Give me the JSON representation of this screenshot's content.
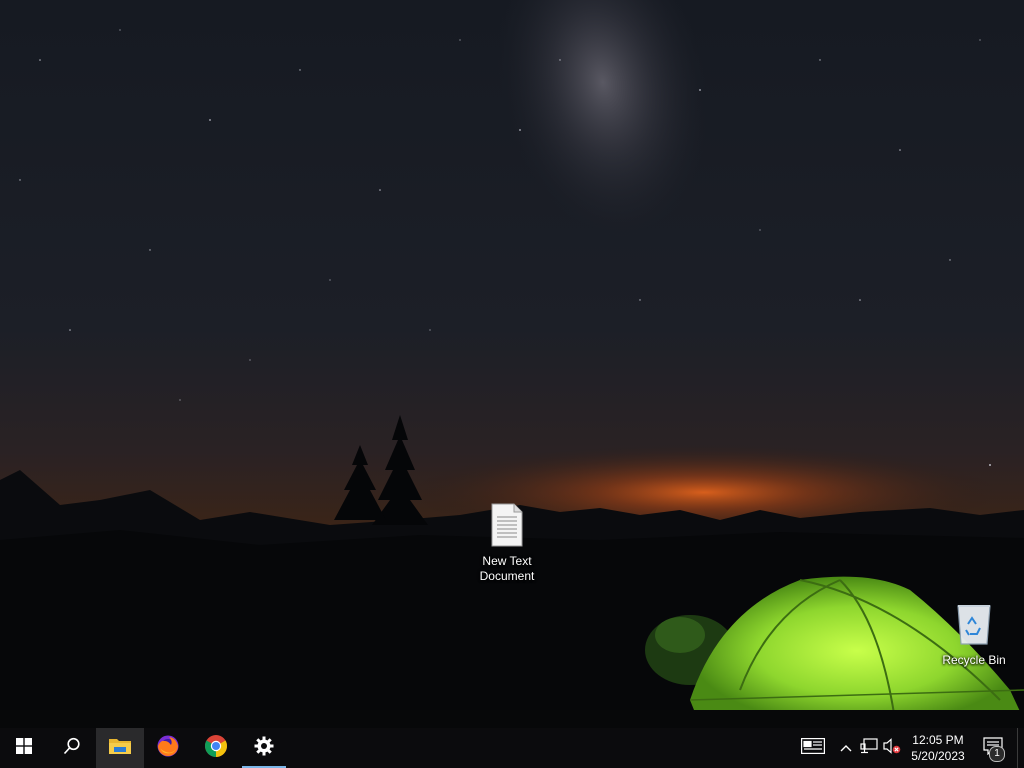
{
  "desktop": {
    "icons": [
      {
        "label": "New Text\nDocument",
        "line1": "New Text",
        "line2": "Document",
        "icon": "text-document-icon"
      },
      {
        "label": "Recycle Bin",
        "icon": "recycle-bin-icon"
      }
    ]
  },
  "taskbar": {
    "start_icon": "windows-logo-icon",
    "search_icon": "search-icon",
    "pinned": [
      {
        "name": "File Explorer",
        "icon": "folder-icon",
        "active": true
      },
      {
        "name": "Firefox",
        "icon": "firefox-icon"
      },
      {
        "name": "Chrome",
        "icon": "chrome-icon"
      },
      {
        "name": "Settings",
        "icon": "gear-icon",
        "open": true
      }
    ],
    "tray": {
      "news_icon": "news-widget-icon",
      "chevron_icon": "chevron-up-icon",
      "network_icon": "network-icon",
      "volume_icon": "volume-muted-icon",
      "time": "12:05 PM",
      "date": "5/20/2023",
      "notification_count": "1"
    }
  },
  "colors": {
    "taskbar_bg": "#0b0b0d",
    "accent": "#7bb6e8",
    "tent": "#9be33a"
  }
}
